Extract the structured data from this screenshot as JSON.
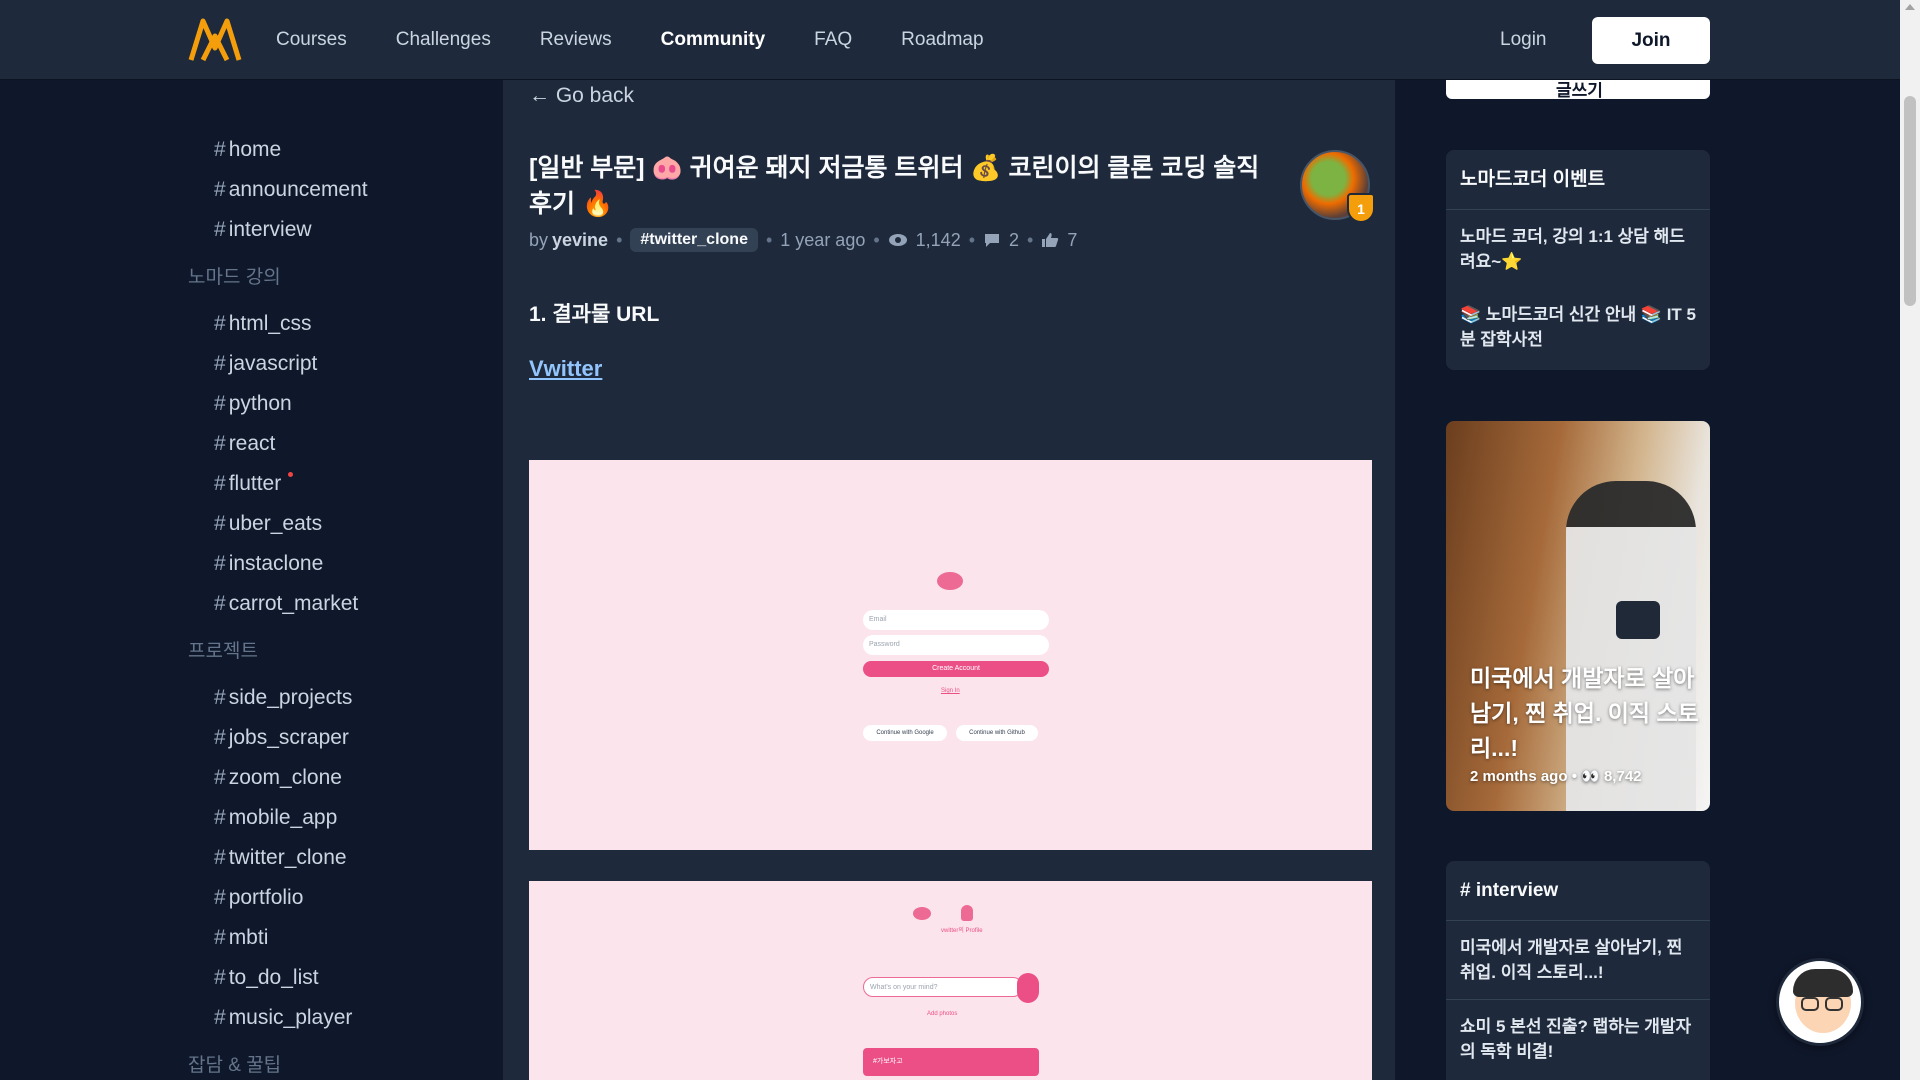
{
  "nav": {
    "links": [
      "Courses",
      "Challenges",
      "Reviews",
      "Community",
      "FAQ",
      "Roadmap"
    ],
    "active": "Community",
    "login": "Login",
    "join": "Join"
  },
  "sidebar": {
    "groups": [
      {
        "section": "",
        "items": [
          "home",
          "announcement",
          "interview"
        ]
      },
      {
        "section": "노마드 강의",
        "items": [
          "html_css",
          "javascript",
          "python",
          "react",
          "flutter",
          "uber_eats",
          "instaclone",
          "carrot_market"
        ]
      },
      {
        "section": "프로젝트",
        "items": [
          "side_projects",
          "jobs_scraper",
          "zoom_clone",
          "mobile_app",
          "twitter_clone",
          "portfolio",
          "mbti",
          "to_do_list",
          "music_player"
        ]
      },
      {
        "section": "잡담 & 꿀팁",
        "items": []
      }
    ],
    "hash": "#"
  },
  "post": {
    "go_back": "← Go back",
    "title": "[일반 부문] 🐽 귀여운 돼지 저금통 트위터 💰 코린이의 클론 코딩 솔직 후기 🔥",
    "by": "by",
    "author": "yevine",
    "tag": "#twitter_clone",
    "time": "1 year ago",
    "views": "1,142",
    "comments": "2",
    "likes": "7",
    "avatar_badge": "1",
    "section_heading": "1. 결과물 URL",
    "link_text": "Vwitter",
    "shot1": {
      "email_ph": "Email",
      "password_ph": "Password",
      "create_btn": "Create Account",
      "sign_in": "Sign In",
      "google": "Continue with Google",
      "github": "Continue with Github"
    },
    "shot2": {
      "profile": "vwitter의 Profile",
      "whats_ph": "What's on your mind?",
      "add_photos": "Add photos",
      "tweet": "#가보자고"
    }
  },
  "right": {
    "top_button": "글쓰기",
    "events": {
      "title": "노마드코더 이벤트",
      "items": [
        "노마드 코더, 강의 1:1 상담 해드려요~⭐",
        "📚 노마드코더 신간 안내 📚 IT 5분 잡학사전"
      ]
    },
    "promo": {
      "title": "미국에서 개발자로 살아남기, 찐 취업. 이직 스토리...!",
      "time": "2 months ago",
      "views": "8,742"
    },
    "interview": {
      "title": "# interview",
      "items": [
        "미국에서 개발자로 살아남기, 찐 취업. 이직 스토리...!",
        "쇼미 5 본선 진출? 랩하는 개발자의 독학 비결!"
      ]
    }
  },
  "colors": {
    "page_bg": "#0f172a",
    "panel_bg": "#1e293b",
    "accent_logo": "#f59e0b",
    "link": "#93c5fd",
    "shot_bg": "#fce4ec",
    "shot_accent": "#ec4f86"
  },
  "icons": [
    "logo-icon",
    "eye-icon",
    "comment-icon",
    "thumbs-up-icon",
    "chat-avatar-icon"
  ]
}
